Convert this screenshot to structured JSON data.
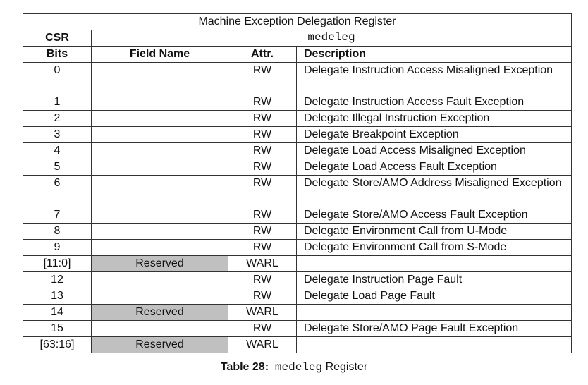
{
  "title": "Machine Exception Delegation Register",
  "csr_label": "CSR",
  "csr_value": "medeleg",
  "headers": [
    "Bits",
    "Field Name",
    "Attr.",
    "Description"
  ],
  "rows": [
    {
      "bits": "0",
      "field": "",
      "attr": "RW",
      "desc": "Delegate Instruction Access Misaligned Exception",
      "reserved": false
    },
    {
      "bits": "1",
      "field": "",
      "attr": "RW",
      "desc": "Delegate Instruction Access Fault Exception",
      "reserved": false
    },
    {
      "bits": "2",
      "field": "",
      "attr": "RW",
      "desc": "Delegate Illegal Instruction Exception",
      "reserved": false
    },
    {
      "bits": "3",
      "field": "",
      "attr": "RW",
      "desc": "Delegate Breakpoint Exception",
      "reserved": false
    },
    {
      "bits": "4",
      "field": "",
      "attr": "RW",
      "desc": "Delegate Load Access Misaligned Exception",
      "reserved": false
    },
    {
      "bits": "5",
      "field": "",
      "attr": "RW",
      "desc": "Delegate Load Access Fault Exception",
      "reserved": false
    },
    {
      "bits": "6",
      "field": "",
      "attr": "RW",
      "desc": "Delegate Store/AMO Address Misaligned Exception",
      "reserved": false
    },
    {
      "bits": "7",
      "field": "",
      "attr": "RW",
      "desc": "Delegate Store/AMO Access Fault Exception",
      "reserved": false
    },
    {
      "bits": "8",
      "field": "",
      "attr": "RW",
      "desc": "Delegate Environment Call from U-Mode",
      "reserved": false
    },
    {
      "bits": "9",
      "field": "",
      "attr": "RW",
      "desc": "Delegate Environment Call from S-Mode",
      "reserved": false
    },
    {
      "bits": "[11:0]",
      "field": "Reserved",
      "attr": "WARL",
      "desc": "",
      "reserved": true
    },
    {
      "bits": "12",
      "field": "",
      "attr": "RW",
      "desc": "Delegate Instruction Page Fault",
      "reserved": false
    },
    {
      "bits": "13",
      "field": "",
      "attr": "RW",
      "desc": "Delegate Load Page Fault",
      "reserved": false
    },
    {
      "bits": "14",
      "field": "Reserved",
      "attr": "WARL",
      "desc": "",
      "reserved": true
    },
    {
      "bits": "15",
      "field": "",
      "attr": "RW",
      "desc": "Delegate Store/AMO Page Fault Exception",
      "reserved": false
    },
    {
      "bits": "[63:16]",
      "field": "Reserved",
      "attr": "WARL",
      "desc": "",
      "reserved": true
    }
  ],
  "caption": {
    "label": "Table 28:",
    "reg": "medeleg",
    "suffix": "Register"
  },
  "colors": {
    "reserved": "#c0c0c0",
    "border": "#333333"
  }
}
